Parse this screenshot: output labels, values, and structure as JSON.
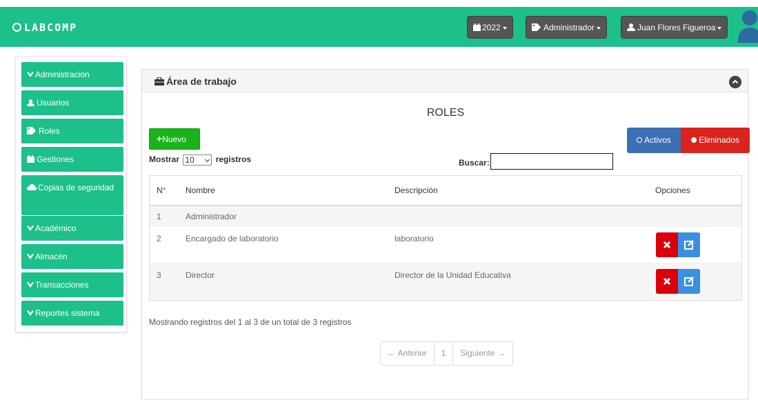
{
  "app": {
    "brand": "LABCOMP"
  },
  "topbar": {
    "year_label": "2022",
    "role_label": "Administrador",
    "user_label": "Juan Flores Figueroa"
  },
  "sidebar": {
    "items": [
      {
        "label": "Administración",
        "icon": "chevron-down-icon"
      },
      {
        "label": "Usuarios",
        "icon": "user-icon"
      },
      {
        "label": "Roles",
        "icon": "tag-icon"
      },
      {
        "label": "Gestiones",
        "icon": "calendar-icon"
      },
      {
        "label": "Copias de seguridad",
        "icon": "cloud-icon"
      },
      {
        "label": "Académico",
        "icon": "chevron-down-icon"
      },
      {
        "label": "Almacén",
        "icon": "chevron-down-icon"
      },
      {
        "label": "Transacciones",
        "icon": "chevron-down-icon"
      },
      {
        "label": "Reportes sistema",
        "icon": "chevron-down-icon"
      }
    ]
  },
  "workspace": {
    "title": "Área de trabajo",
    "page_title": "ROLES",
    "new_button": "Nuevo",
    "active_button": "Activos",
    "deleted_button": "Eliminados",
    "show_label": "Mostrar",
    "records_label": "registros",
    "page_size": "10",
    "search_label": "Buscar:",
    "search_value": ""
  },
  "table": {
    "headers": [
      "N°",
      "Nombre",
      "Descripción",
      "Opciones"
    ],
    "rows": [
      {
        "n": "1",
        "name": "Administrador",
        "description": ""
      },
      {
        "n": "2",
        "name": "Encargado de laboratorio",
        "description": "laboratorio"
      },
      {
        "n": "3",
        "name": "Director",
        "description": "Director de la Unidad Educativa"
      }
    ]
  },
  "footer": {
    "info": "Mostrando registros del 1 al 3 de un total de 3 registros",
    "prev": "← Anterior",
    "page": "1",
    "next": "Siguiente →"
  },
  "colors": {
    "topbar": "#1dbf8a",
    "sidebar_item": "#1dbf8a",
    "new_button": "#19b419",
    "active_button": "#3d6fb4",
    "deleted_button": "#d9231c",
    "delete_action": "#d9000c",
    "edit_action": "#3a8fe0"
  }
}
